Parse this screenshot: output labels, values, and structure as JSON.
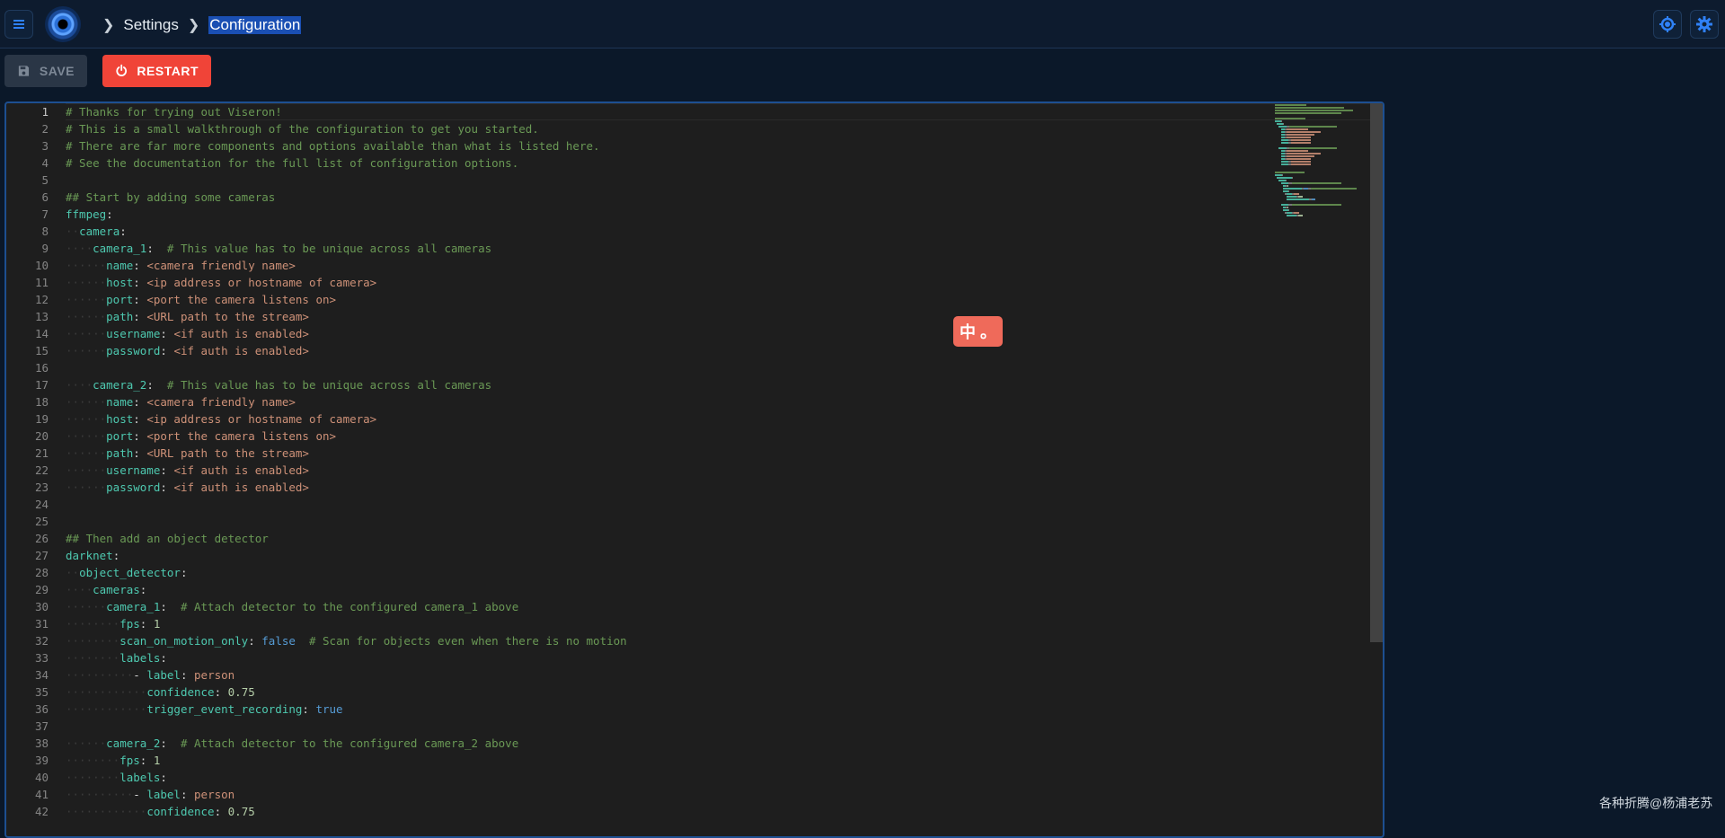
{
  "header": {
    "breadcrumb": [
      "Settings",
      "Configuration"
    ]
  },
  "toolbar": {
    "save_label": "SAVE",
    "restart_label": "RESTART"
  },
  "editor": {
    "active_line": 1,
    "lines": [
      [
        [
          "c",
          "# Thanks for trying out Viseron!"
        ]
      ],
      [
        [
          "c",
          "# This is a small walkthrough of the configuration to get you started."
        ]
      ],
      [
        [
          "c",
          "# There are far more components and options available than what is listed here."
        ]
      ],
      [
        [
          "c",
          "# See the documentation for the full list of configuration options."
        ]
      ],
      [],
      [
        [
          "c",
          "## Start by adding some cameras"
        ]
      ],
      [
        [
          "k",
          "ffmpeg"
        ],
        [
          "p",
          ":"
        ]
      ],
      [
        [
          "w",
          "  "
        ],
        [
          "k",
          "camera"
        ],
        [
          "p",
          ":"
        ]
      ],
      [
        [
          "w",
          "    "
        ],
        [
          "k",
          "camera_1"
        ],
        [
          "p",
          ":  "
        ],
        [
          "c",
          "# This value has to be unique across all cameras"
        ]
      ],
      [
        [
          "w",
          "      "
        ],
        [
          "k",
          "name"
        ],
        [
          "p",
          ": "
        ],
        [
          "s",
          "<camera friendly name>"
        ]
      ],
      [
        [
          "w",
          "      "
        ],
        [
          "k",
          "host"
        ],
        [
          "p",
          ": "
        ],
        [
          "s",
          "<ip address or hostname of camera>"
        ]
      ],
      [
        [
          "w",
          "      "
        ],
        [
          "k",
          "port"
        ],
        [
          "p",
          ": "
        ],
        [
          "s",
          "<port the camera listens on>"
        ]
      ],
      [
        [
          "w",
          "      "
        ],
        [
          "k",
          "path"
        ],
        [
          "p",
          ": "
        ],
        [
          "s",
          "<URL path to the stream>"
        ]
      ],
      [
        [
          "w",
          "      "
        ],
        [
          "k",
          "username"
        ],
        [
          "p",
          ": "
        ],
        [
          "s",
          "<if auth is enabled>"
        ]
      ],
      [
        [
          "w",
          "      "
        ],
        [
          "k",
          "password"
        ],
        [
          "p",
          ": "
        ],
        [
          "s",
          "<if auth is enabled>"
        ]
      ],
      [],
      [
        [
          "w",
          "    "
        ],
        [
          "k",
          "camera_2"
        ],
        [
          "p",
          ":  "
        ],
        [
          "c",
          "# This value has to be unique across all cameras"
        ]
      ],
      [
        [
          "w",
          "      "
        ],
        [
          "k",
          "name"
        ],
        [
          "p",
          ": "
        ],
        [
          "s",
          "<camera friendly name>"
        ]
      ],
      [
        [
          "w",
          "      "
        ],
        [
          "k",
          "host"
        ],
        [
          "p",
          ": "
        ],
        [
          "s",
          "<ip address or hostname of camera>"
        ]
      ],
      [
        [
          "w",
          "      "
        ],
        [
          "k",
          "port"
        ],
        [
          "p",
          ": "
        ],
        [
          "s",
          "<port the camera listens on>"
        ]
      ],
      [
        [
          "w",
          "      "
        ],
        [
          "k",
          "path"
        ],
        [
          "p",
          ": "
        ],
        [
          "s",
          "<URL path to the stream>"
        ]
      ],
      [
        [
          "w",
          "      "
        ],
        [
          "k",
          "username"
        ],
        [
          "p",
          ": "
        ],
        [
          "s",
          "<if auth is enabled>"
        ]
      ],
      [
        [
          "w",
          "      "
        ],
        [
          "k",
          "password"
        ],
        [
          "p",
          ": "
        ],
        [
          "s",
          "<if auth is enabled>"
        ]
      ],
      [],
      [],
      [
        [
          "c",
          "## Then add an object detector"
        ]
      ],
      [
        [
          "k",
          "darknet"
        ],
        [
          "p",
          ":"
        ]
      ],
      [
        [
          "w",
          "  "
        ],
        [
          "k",
          "object_detector"
        ],
        [
          "p",
          ":"
        ]
      ],
      [
        [
          "w",
          "    "
        ],
        [
          "k",
          "cameras"
        ],
        [
          "p",
          ":"
        ]
      ],
      [
        [
          "w",
          "      "
        ],
        [
          "k",
          "camera_1"
        ],
        [
          "p",
          ":  "
        ],
        [
          "c",
          "# Attach detector to the configured camera_1 above"
        ]
      ],
      [
        [
          "w",
          "        "
        ],
        [
          "k",
          "fps"
        ],
        [
          "p",
          ": "
        ],
        [
          "n",
          "1"
        ]
      ],
      [
        [
          "w",
          "        "
        ],
        [
          "k",
          "scan_on_motion_only"
        ],
        [
          "p",
          ": "
        ],
        [
          "b",
          "false"
        ],
        [
          "p",
          "  "
        ],
        [
          "c",
          "# Scan for objects even when there is no motion"
        ]
      ],
      [
        [
          "w",
          "        "
        ],
        [
          "k",
          "labels"
        ],
        [
          "p",
          ":"
        ]
      ],
      [
        [
          "w",
          "          "
        ],
        [
          "p",
          "- "
        ],
        [
          "k",
          "label"
        ],
        [
          "p",
          ": "
        ],
        [
          "s",
          "person"
        ]
      ],
      [
        [
          "w",
          "            "
        ],
        [
          "k",
          "confidence"
        ],
        [
          "p",
          ": "
        ],
        [
          "n",
          "0.75"
        ]
      ],
      [
        [
          "w",
          "            "
        ],
        [
          "k",
          "trigger_event_recording"
        ],
        [
          "p",
          ": "
        ],
        [
          "b",
          "true"
        ]
      ],
      [],
      [
        [
          "w",
          "      "
        ],
        [
          "k",
          "camera_2"
        ],
        [
          "p",
          ":  "
        ],
        [
          "c",
          "# Attach detector to the configured camera_2 above"
        ]
      ],
      [
        [
          "w",
          "        "
        ],
        [
          "k",
          "fps"
        ],
        [
          "p",
          ": "
        ],
        [
          "n",
          "1"
        ]
      ],
      [
        [
          "w",
          "        "
        ],
        [
          "k",
          "labels"
        ],
        [
          "p",
          ":"
        ]
      ],
      [
        [
          "w",
          "          "
        ],
        [
          "p",
          "- "
        ],
        [
          "k",
          "label"
        ],
        [
          "p",
          ": "
        ],
        [
          "s",
          "person"
        ]
      ],
      [
        [
          "w",
          "            "
        ],
        [
          "k",
          "confidence"
        ],
        [
          "p",
          ": "
        ],
        [
          "n",
          "0.75"
        ]
      ]
    ]
  },
  "toast": {
    "text": "中 。"
  },
  "watermark": "各种折腾@杨浦老苏",
  "colors": {
    "accent": "#1a4fb3",
    "restart": "#f04438",
    "editor_bg": "#1e1e1e",
    "key": "#4ec9b0",
    "comment": "#6a9955",
    "string": "#ce9178"
  },
  "icons": [
    "menu-icon",
    "logo-icon",
    "chevron-right-icon",
    "save-icon",
    "restart-icon",
    "theme-icon",
    "settings-gear-icon"
  ]
}
